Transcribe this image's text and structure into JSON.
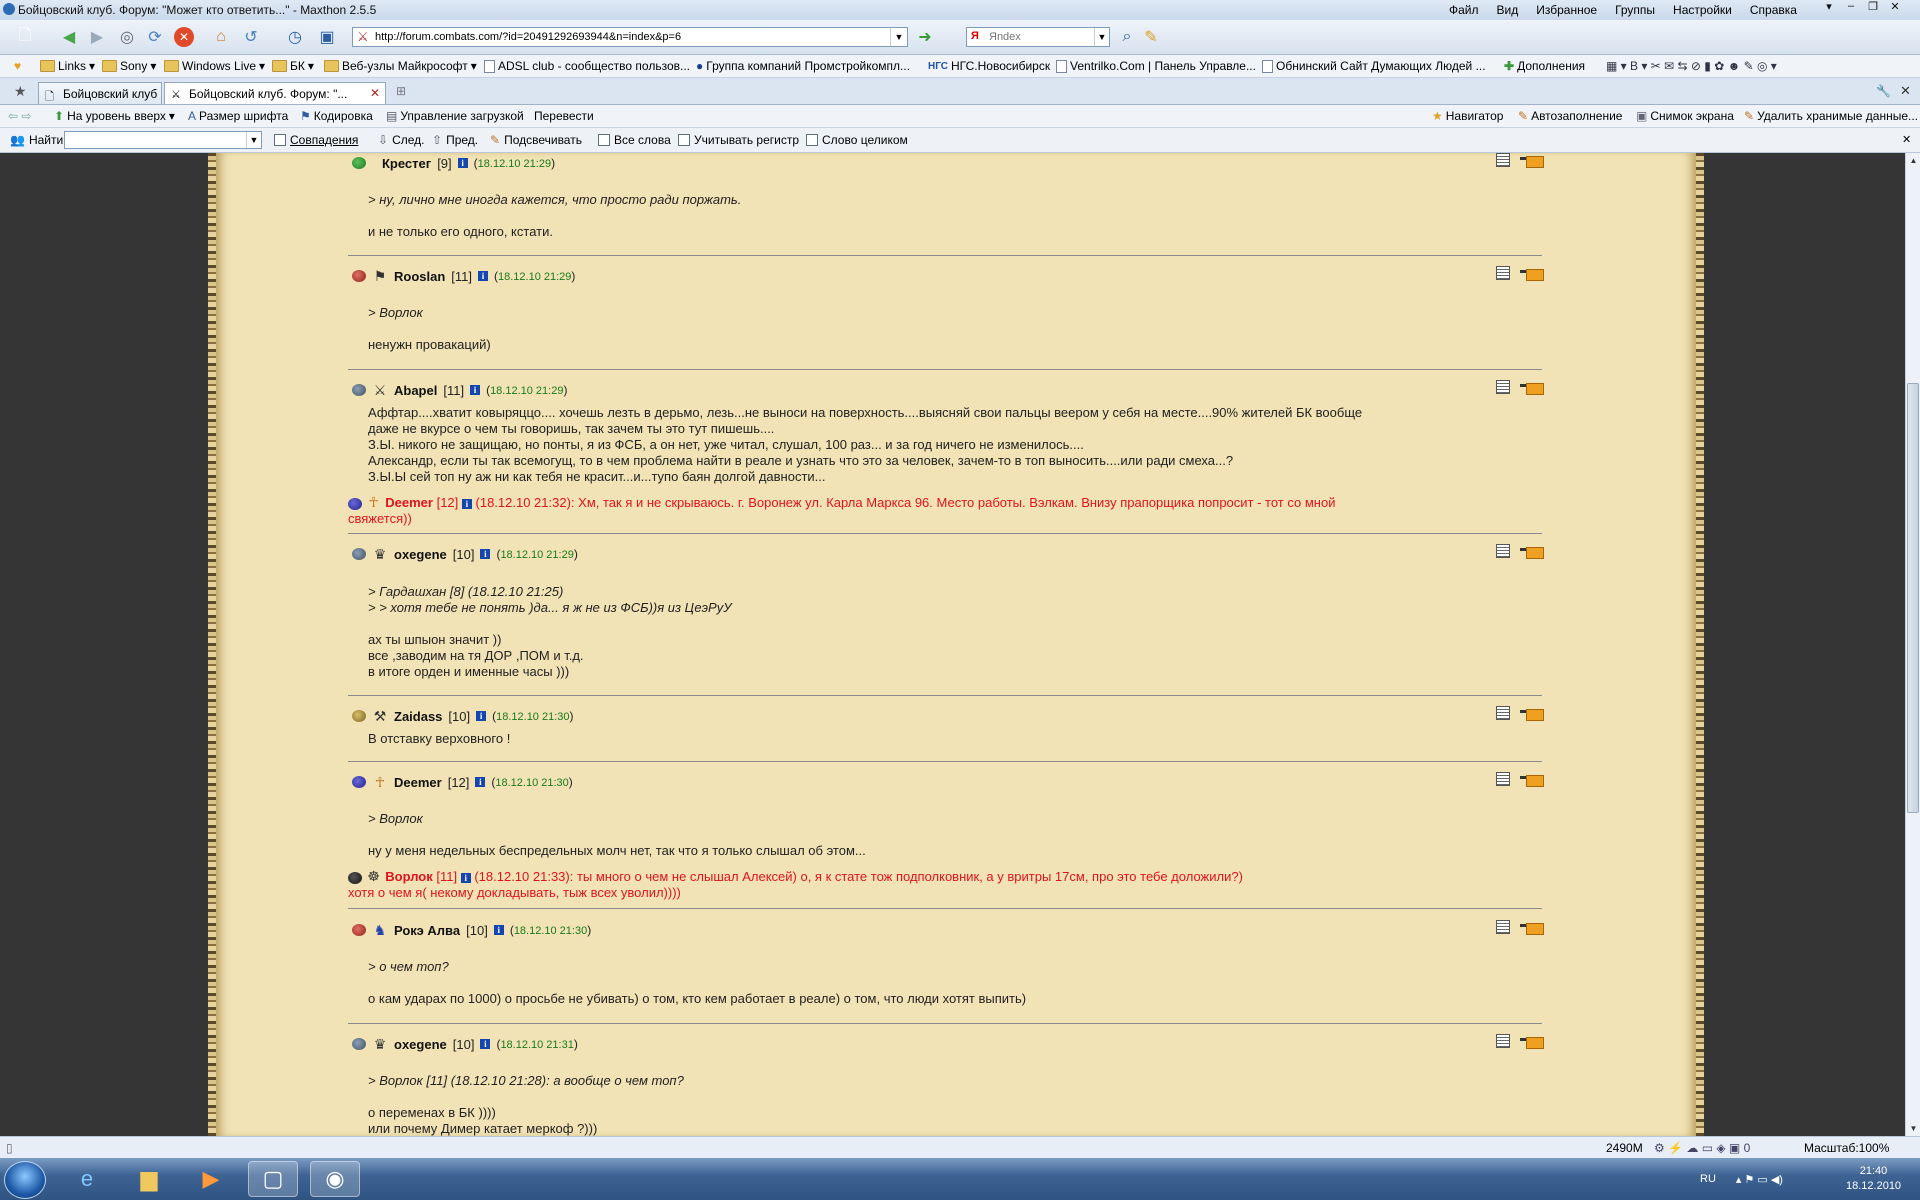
{
  "window": {
    "title": "Бойцовский клуб. Форум: \"Может кто ответить...\" - Maxthon 2.5.5",
    "menu": [
      "Файл",
      "Вид",
      "Избранное",
      "Группы",
      "Настройки",
      "Справка"
    ]
  },
  "address": {
    "url": "http://forum.combats.com/?id=20491292693944&n=index&p=6"
  },
  "search": {
    "placeholder": "Яndex"
  },
  "favorites": [
    "Links",
    "Sony",
    "Windows Live",
    "БК",
    "Веб-узлы Майкрософт",
    "ADSL club - сообщество пользов...",
    "Группа компаний Промстройкомпл...",
    "НГС.Новосибирск",
    "Ventrilko.Com | Панель Управле...",
    "Обнинский Сайт Думающих Людей ...",
    "Дополнения"
  ],
  "tabs": [
    {
      "label": "Бойцовский клуб"
    },
    {
      "label": "Бойцовский клуб. Форум: \"..."
    }
  ],
  "navbar": {
    "left": [
      "На уровень вверх",
      "Размер шрифта",
      "Кодировка",
      "Управление загрузкой",
      "Перевести"
    ],
    "right": [
      "Навигатор",
      "Автозаполнение",
      "Снимок экрана",
      "Удалить хранимые данные..."
    ]
  },
  "findbar": {
    "label": "Найти",
    "matches": "Совпадения",
    "next": "След.",
    "prev": "Пред.",
    "highlight": "Подсвечивать",
    "all_words": "Все слова",
    "case": "Учитывать регистр",
    "whole_word": "Слово целиком"
  },
  "posts": [
    {
      "nick": "Крестег",
      "level": "[9]",
      "date": "18.12.10 21:29",
      "lines": [
        {
          "text": "> ну, лично мне иногда кажется, что просто ради поржать.",
          "quote": true
        },
        {
          "text": "",
          "quote": false
        },
        {
          "text": "и не только его одного, кстати.",
          "quote": false
        }
      ]
    },
    {
      "nick": "Rooslan",
      "level": "[11]",
      "date": "18.12.10 21:29",
      "lines": [
        {
          "text": "> Ворлок",
          "quote": true
        },
        {
          "text": "",
          "quote": false
        },
        {
          "text": "ненужн провакаций)",
          "quote": false
        }
      ]
    },
    {
      "nick": "Abapel",
      "level": "[11]",
      "date": "18.12.10 21:29",
      "lines": [
        {
          "text": "Аффтар....хватит ковыряццо.... хочешь лезть в дерьмо, лезь...не выноси на поверхность....выясняй свои пальцы веером у себя на месте....90% жителей БК вообще",
          "quote": false
        },
        {
          "text": "даже не вкурсе о чем ты говоришь, так зачем ты это тут пишешь....",
          "quote": false
        },
        {
          "text": "З.Ы. никого не защищаю, но понты, я из ФСБ, а он нет, уже читал, слушал, 100 раз... и за год ничего не изменилось....",
          "quote": false
        },
        {
          "text": "Александр, если ты так всемогущ, то в чем проблема найти в реале и узнать что это за человек, зачем-то в топ выносить....или ради смеха...?",
          "quote": false
        },
        {
          "text": "З.Ы.Ы сей топ ну аж ни как тебя не красит...и...тупо баян долгой давности...",
          "quote": false
        }
      ]
    },
    {
      "nick": "oxegene",
      "level": "[10]",
      "date": "18.12.10 21:29",
      "lines": [
        {
          "text": ">   Гардашхан [8] (18.12.10 21:25)",
          "quote": true
        },
        {
          "text": "> > хотя тебе не понять )да... я ж не из ФСБ))я из ЦеэРуУ",
          "quote": true
        },
        {
          "text": "",
          "quote": false
        },
        {
          "text": "ах ты шпыон значит ))",
          "quote": false
        },
        {
          "text": "все ,заводим на тя ДОР ,ПОМ и т.д.",
          "quote": false
        },
        {
          "text": "в итоге орден и именные часы )))",
          "quote": false
        }
      ]
    },
    {
      "nick": "Zaidass",
      "level": "[10]",
      "date": "18.12.10 21:30",
      "lines": [
        {
          "text": "В отставку верховного !",
          "quote": false
        }
      ]
    },
    {
      "nick": "Deemer",
      "level": "[12]",
      "date": "18.12.10 21:30",
      "lines": [
        {
          "text": "> Ворлок",
          "quote": true
        },
        {
          "text": "",
          "quote": false
        },
        {
          "text": "ну у меня недельных беспредельных молч нет, так что я только слышал об этом...",
          "quote": false
        }
      ]
    },
    {
      "nick": "Рокэ Алва",
      "level": "[10]",
      "date": "18.12.10 21:30",
      "lines": [
        {
          "text": "> о чем топ?",
          "quote": true
        },
        {
          "text": "",
          "quote": false
        },
        {
          "text": "о кам ударах по 1000) о просьбе не убивать) о том, кто кем работает в реале) о том, что люди хотят выпить)",
          "quote": false
        }
      ]
    },
    {
      "nick": "oxegene",
      "level": "[10]",
      "date": "18.12.10 21:31",
      "lines": [
        {
          "text": ">   Ворлок [11] (18.12.10 21:28): а вообще о чем топ?",
          "quote": true
        },
        {
          "text": "",
          "quote": false
        },
        {
          "text": "о переменах в БК ))))",
          "quote": false
        },
        {
          "text": "или почему Димер катает меркоф ?)))",
          "quote": false
        }
      ]
    }
  ],
  "replies": [
    {
      "nick": "Deemer",
      "level": "[12]",
      "text": "(18.12.10 21:32): Хм, так я и не скрываюсь. г. Воронеж ул. Карла Маркса 96. Место работы. Вэлкам. Внизу прапорщика попросит - тот со мной",
      "text2": "свяжется))"
    },
    {
      "nick": "Ворлок",
      "level": "[11]",
      "text": "(18.12.10 21:33): ты много о чем не слышал Алексей) о, я к стате тож подполковник, а у вритры 17см, про это тебе доложили?)",
      "text2": "хотя о чем я( некому докладывать, тыж всех уволил))))"
    }
  ],
  "statusbar": {
    "memory": "2490M",
    "zoom": "Масштаб:100%"
  },
  "tray": {
    "lang": "RU",
    "time": "21:40",
    "date": "18.12.2010"
  }
}
